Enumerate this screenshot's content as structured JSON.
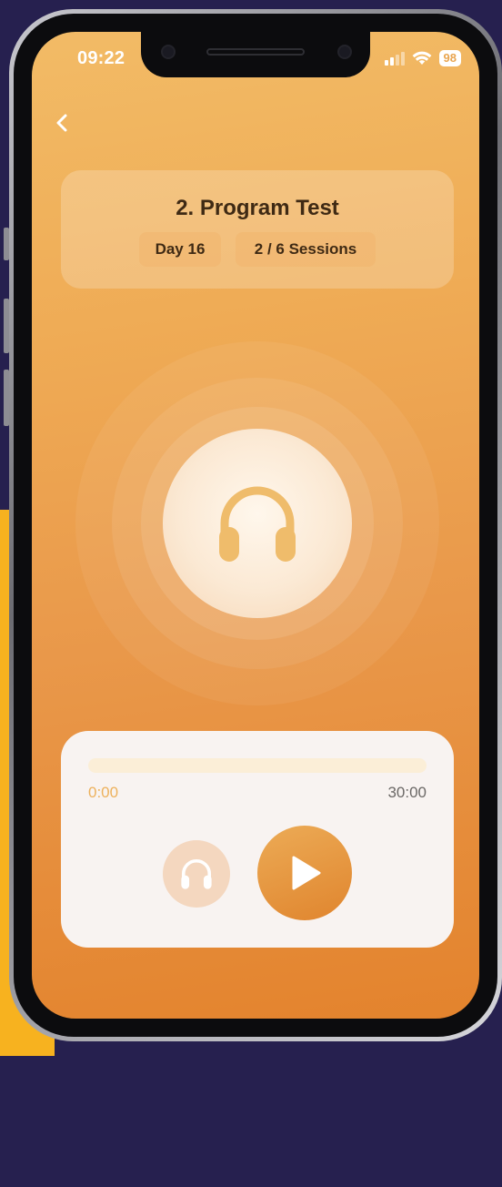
{
  "status_bar": {
    "time": "09:22",
    "battery": "98"
  },
  "program": {
    "title": "2. Program Test",
    "day": "Day 16",
    "sessions": "2 / 6 Sessions"
  },
  "player": {
    "elapsed": "0:00",
    "duration": "30:00",
    "progress": 0
  },
  "icons": [
    "back-icon",
    "headphones-icon",
    "play-icon",
    "wifi-icon",
    "signal-icon"
  ],
  "colors": {
    "accent": "#e9984a",
    "background": "#26204f",
    "card": "#f8f3f1"
  }
}
